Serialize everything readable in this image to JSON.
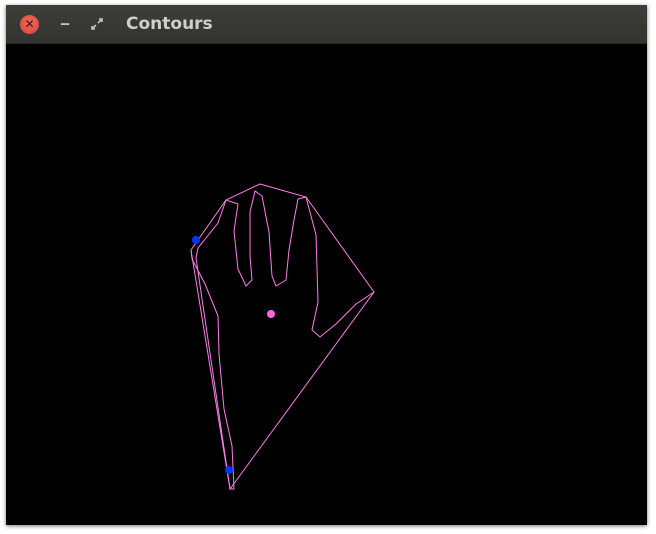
{
  "window": {
    "title": "Contours",
    "close_glyph": "✕",
    "minimize_glyph": "‒"
  },
  "icons": {
    "close": "close-icon",
    "minimize": "minimize-icon",
    "restore": "restore-icon"
  },
  "colors": {
    "contour_stroke": "#ff7ee6",
    "centroid": "#ff66e0",
    "defect_points": "#0033ff",
    "background": "#000000"
  }
}
